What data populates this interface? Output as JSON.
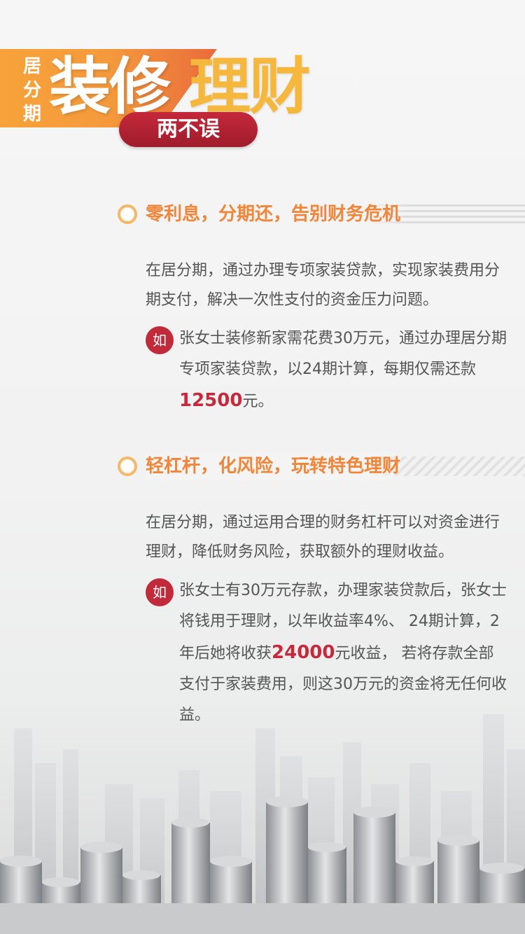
{
  "header": {
    "small_chars": [
      "居",
      "分",
      "期"
    ],
    "big_white": "装修",
    "big_gold": "理财",
    "pill": "两不误"
  },
  "sections": [
    {
      "title": "零利息，分期还，告别财务危机",
      "body": "在居分期，通过办理专项家装贷款，实现家装费用分期支付，解决一次性支付的资金压力问题。",
      "badge": "如",
      "example_pre": "张女士装修新家需花费30万元，通过办理居分期专项家装贷款，以24期计算，每期仅需还款",
      "example_highlight": "12500",
      "example_post": "元。"
    },
    {
      "title": "轻杠杆，化风险，玩转特色理财",
      "body": "在居分期，通过运用合理的财务杠杆可以对资金进行理财，降低财务风险，获取额外的理财收益。",
      "badge": "如",
      "example_pre": "张女士有30万元存款，办理家装贷款后，张女士将钱用于理财，以年收益率4%、 24期计算，2年后她将收获",
      "example_highlight": "24000",
      "example_post": "元收益， 若将存款全部支付于家装费用，则这30万元的资金将无任何收益。"
    }
  ],
  "colors": {
    "orange": "#f0863a",
    "red": "#c12a3a",
    "gold": "#f5b83d"
  }
}
